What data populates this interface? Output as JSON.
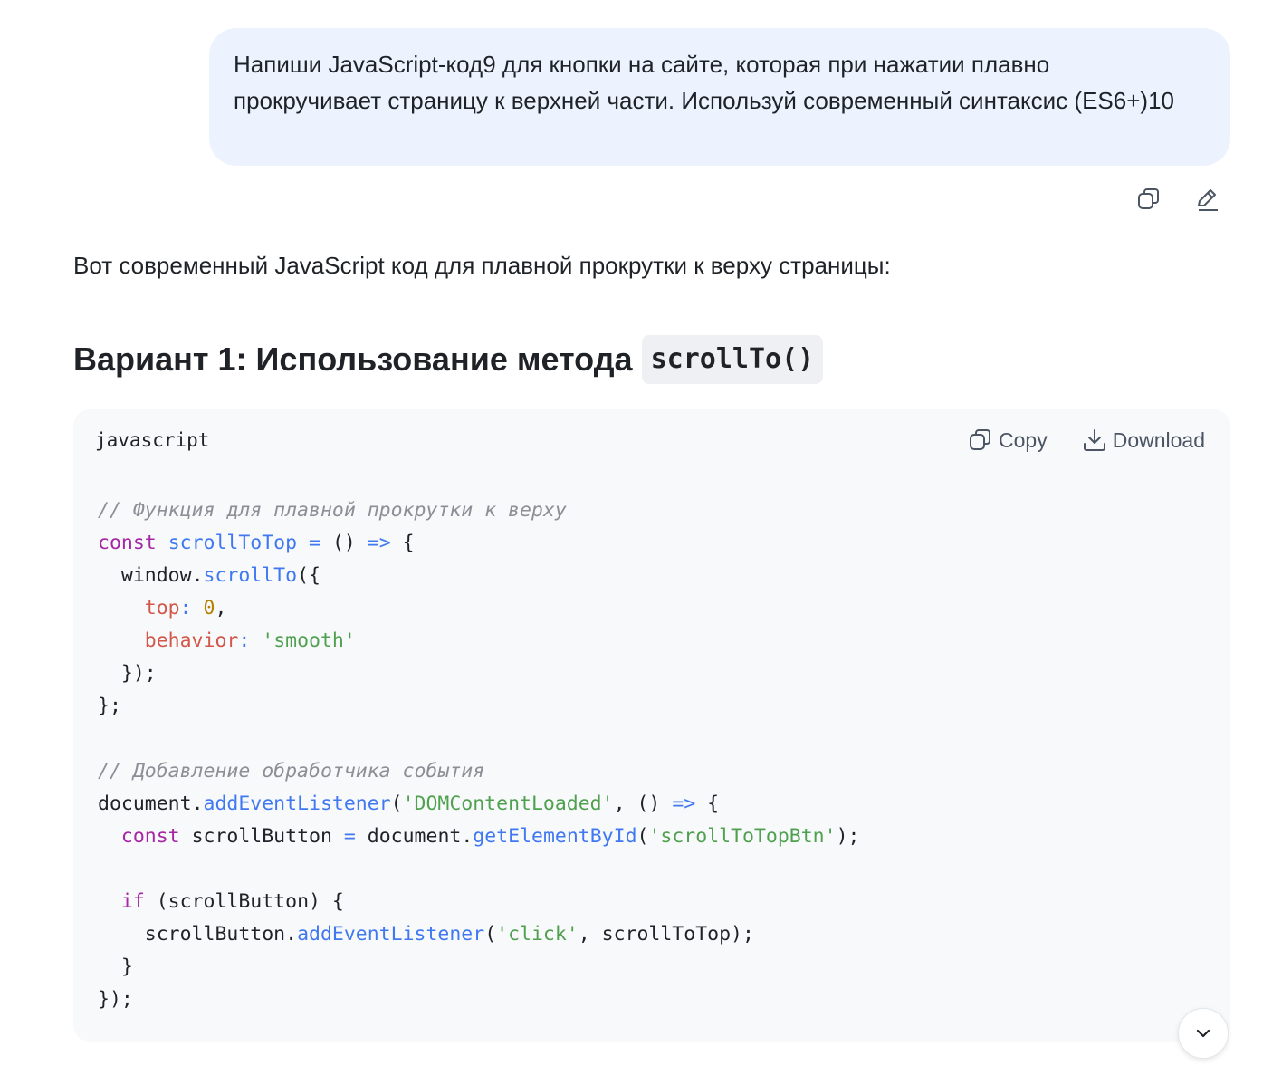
{
  "user_message": {
    "text": "Напиши JavaScript-код9 для кнопки на сайте, которая при нажатии плавно прокручивает страницу к верхней части. Используй современный синтаксис (ES6+)10"
  },
  "message_actions": {
    "copy_icon": "copy-icon",
    "edit_icon": "pencil-icon"
  },
  "assistant": {
    "intro": "Вот современный JavaScript код для плавной прокрутки к верху страницы:",
    "heading_text": "Вариант 1: Использование метода",
    "heading_code": "scrollTo()",
    "code_block": {
      "language": "javascript",
      "copy_label": "Copy",
      "download_label": "Download",
      "lines": {
        "l1": "// Функция для плавной прокрутки к верху",
        "l2_kw": "const",
        "l2_fn": "scrollToTop",
        "l2_eq": "=",
        "l2_args": "()",
        "l2_arrow": "=>",
        "l2_brace": "{",
        "l3_obj": "window",
        "l3_fn": "scrollTo",
        "l3_rest": "({",
        "l4_prop": "top",
        "l4_num": "0",
        "l5_prop": "behavior",
        "l5_str": "'smooth'",
        "l6": "});",
        "l7": "};",
        "l9": "// Добавление обработчика события",
        "l10_obj": "document",
        "l10_fn": "addEventListener",
        "l10_str": "'DOMContentLoaded'",
        "l10_args": "()",
        "l10_arrow": "=>",
        "l10_brace": "{",
        "l11_kw": "const",
        "l11_var": "scrollButton",
        "l11_eq": "=",
        "l11_obj": "document",
        "l11_fn": "getElementById",
        "l11_str": "'scrollToTopBtn'",
        "l13_kw": "if",
        "l13_cond": "(scrollButton) {",
        "l14_obj": "scrollButton",
        "l14_fn": "addEventListener",
        "l14_str": "'click'",
        "l14_arg": "scrollToTop",
        "l15": "}",
        "l16": "});"
      }
    }
  },
  "scroll_button": {
    "icon": "chevron-down-icon"
  }
}
